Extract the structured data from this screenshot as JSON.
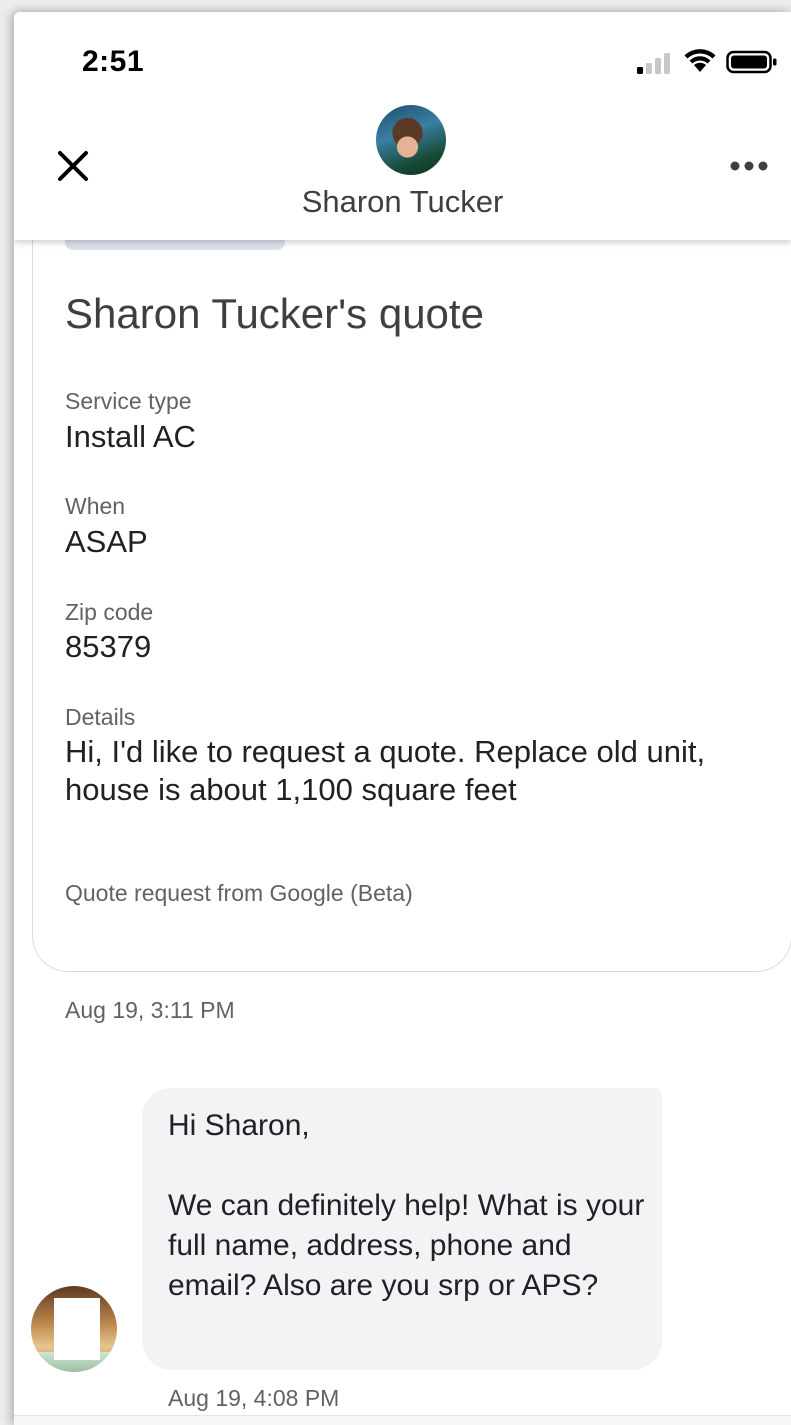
{
  "status_bar": {
    "time": "2:51"
  },
  "header": {
    "contact_name": "Sharon Tucker"
  },
  "quote": {
    "title": "Sharon Tucker's quote",
    "fields": [
      {
        "label": "Service type",
        "value": "Install AC"
      },
      {
        "label": "When",
        "value": "ASAP"
      },
      {
        "label": "Zip code",
        "value": "85379"
      },
      {
        "label": "Details",
        "value": "Hi, I'd like to request a quote. Replace old unit, house is about 1,100 square feet"
      }
    ],
    "source": "Quote request from Google (Beta)",
    "timestamp": "Aug 19, 3:11 PM"
  },
  "messages": [
    {
      "text": "Hi Sharon,\n\nWe can definitely help! What is your full name, address, phone and email? Also are you srp or APS?",
      "timestamp": "Aug 19, 4:08 PM"
    }
  ],
  "icons": {
    "close": "close-icon",
    "more": "more-horizontal-icon",
    "signal": "cellular-signal-icon",
    "wifi": "wifi-icon",
    "battery": "battery-icon"
  }
}
